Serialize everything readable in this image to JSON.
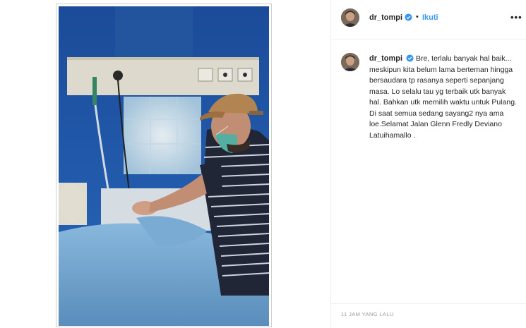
{
  "post": {
    "username": "dr_tompi",
    "follow_label": "Ikuti",
    "dot": "•",
    "more_label": "•••",
    "caption": "Bre, terlalu banyak hal baik... meskipun kita belum lama berteman hingga bersaudara tp rasanya seperti sepanjang masa. Lo selalu tau yg terbaik utk banyak hal. Bahkan utk memilih waktu untuk Pulang. Di saat semua sedang sayang2 nya ama loe.Selamat Jalan Glenn Fredly Deviano Latuihamallo .",
    "timestamp": "11 JAM YANG LALU"
  },
  "colors": {
    "accent": "#3897f0",
    "verified": "#3897f0",
    "text": "#262626",
    "muted": "#999999",
    "divider": "#efefef"
  },
  "icons": {
    "verified": "verified-badge-icon",
    "more": "more-options-icon"
  }
}
